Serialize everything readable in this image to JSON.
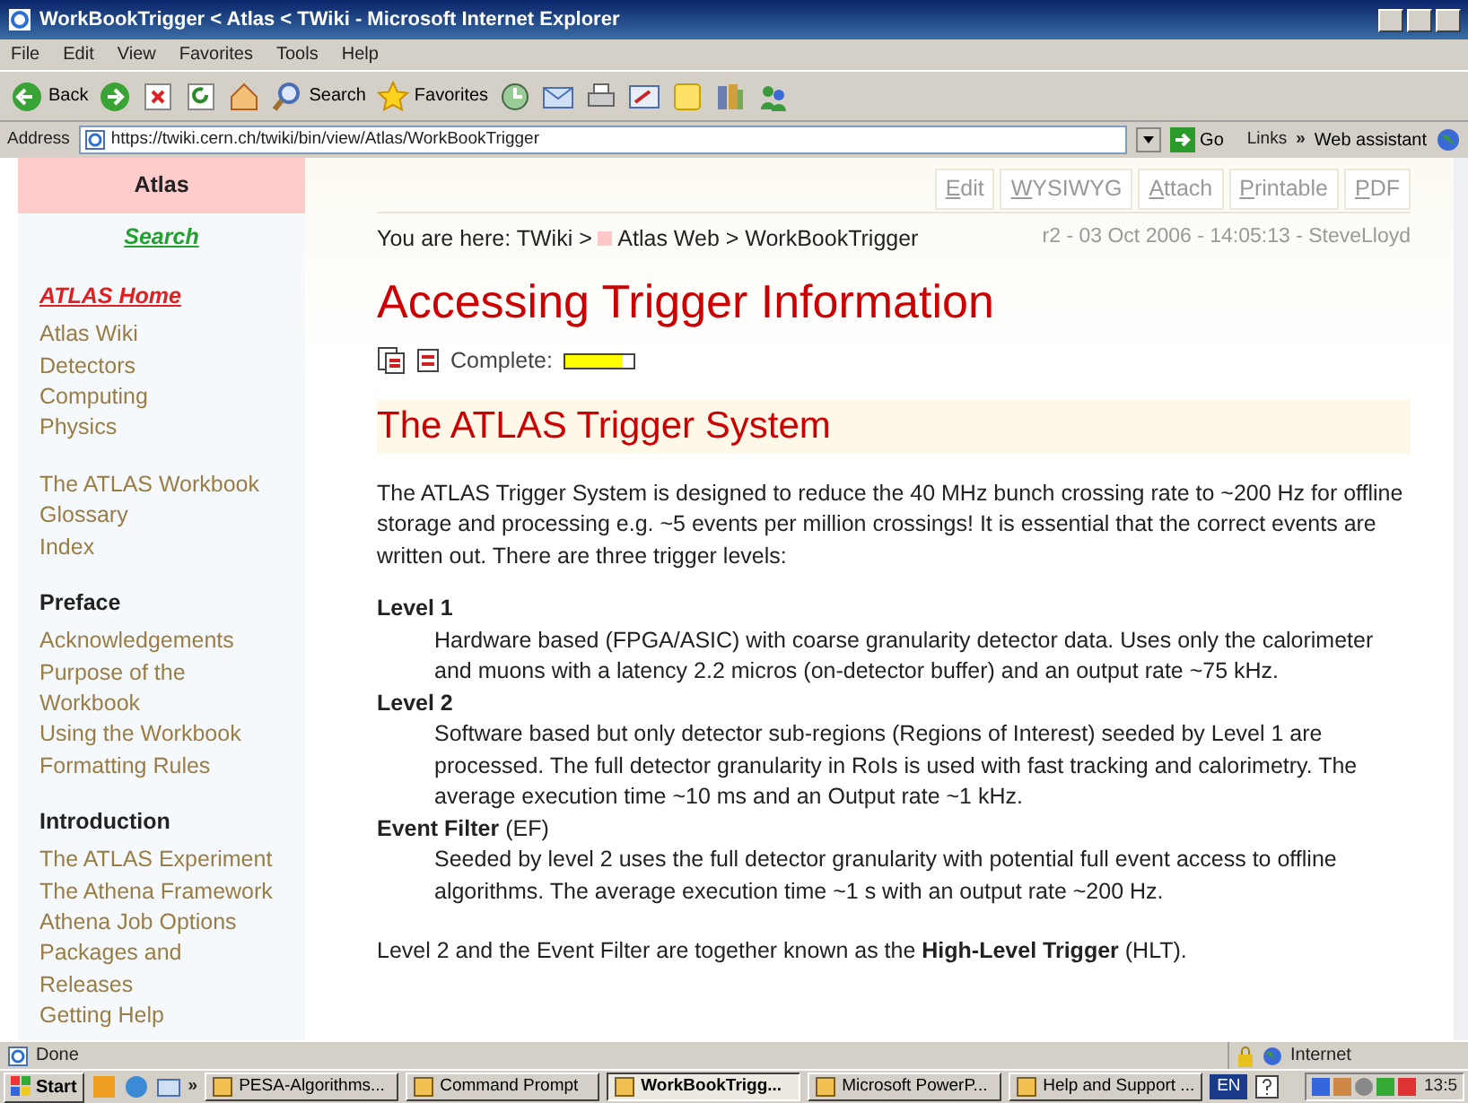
{
  "window": {
    "title": "WorkBookTrigger < Atlas < TWiki - Microsoft Internet Explorer"
  },
  "menu": [
    "File",
    "Edit",
    "View",
    "Favorites",
    "Tools",
    "Help"
  ],
  "toolbar": [
    {
      "kind": "back",
      "label": "Back"
    },
    {
      "kind": "forward"
    },
    {
      "kind": "stop"
    },
    {
      "kind": "refresh"
    },
    {
      "kind": "home"
    },
    {
      "kind": "search",
      "label": "Search"
    },
    {
      "kind": "favorites",
      "label": "Favorites"
    },
    {
      "kind": "history"
    },
    {
      "kind": "mail"
    },
    {
      "kind": "print"
    },
    {
      "kind": "edit"
    },
    {
      "kind": "note"
    },
    {
      "kind": "research"
    },
    {
      "kind": "messenger"
    }
  ],
  "address": {
    "label": "Address",
    "url": "https://twiki.cern.ch/twiki/bin/view/Atlas/WorkBookTrigger",
    "go": "Go",
    "links": "Links",
    "chevron": "»",
    "assistant": "Web assistant"
  },
  "sidebar": {
    "header": "Atlas",
    "search": "Search",
    "home": "ATLAS Home",
    "sections": [
      {
        "links": [
          "Atlas Wiki",
          "Detectors",
          "Computing",
          "Physics"
        ]
      },
      {
        "links": [
          "The ATLAS Workbook",
          "Glossary",
          "Index"
        ]
      },
      {
        "heading": "Preface",
        "links": [
          "Acknowledgements",
          "Purpose of the Workbook",
          "Using the Workbook",
          "Formatting Rules"
        ]
      },
      {
        "heading": "Introduction",
        "links": [
          "The ATLAS Experiment",
          "The Athena Framework",
          "Athena Job Options",
          "Packages and Releases",
          "Getting Help"
        ]
      }
    ]
  },
  "actions": [
    "Edit",
    "WYSIWYG",
    "Attach",
    "Printable",
    "PDF"
  ],
  "breadcrumb": {
    "prefix": "You are here:",
    "links": [
      "TWiki",
      "Atlas Web"
    ],
    "separator": ">",
    "current": "WorkBookTrigger"
  },
  "revision": "r2 - 03 Oct 2006 - 14:05:13 - SteveLloyd",
  "title": "Accessing Trigger Information",
  "complete": {
    "label": "Complete:",
    "level": 0.85
  },
  "section_title": "The ATLAS Trigger System",
  "intro": "The ATLAS Trigger System is designed to reduce the 40 MHz bunch crossing rate to ~200 Hz for offline storage and processing e.g. ~5 events per million crossings! It is essential that the correct events are written out. There are three trigger levels:",
  "levels": [
    {
      "term": "Level 1",
      "description": "Hardware based (FPGA/ASIC) with coarse granularity detector data. Uses only the calorimeter and muons with a latency 2.2 micros (on-detector buffer) and an output rate ~75 kHz."
    },
    {
      "term": "Level 2",
      "description": "Software based but only detector sub-regions (Regions of Interest) seeded by Level 1 are processed. The full detector granularity in RoIs is used with fast tracking and calorimetry. The average execution time ~10 ms and an Output rate ~1 kHz."
    },
    {
      "term": "Event Filter",
      "note": "(EF)",
      "description": "Seeded by level 2 uses the full detector granularity with potential full event access to offline algorithms. The average execution time ~1 s with an output rate ~200 Hz."
    }
  ],
  "closing": "Level 2 and the Event Filter are together known as the **High-Level Trigger** (HLT).",
  "status_bar": {
    "text": "Done",
    "zone": "Internet"
  },
  "taskbar": {
    "start": "Start",
    "chevron": "»",
    "tasks": [
      {
        "label": "PESA-Algorithms...",
        "selected": false
      },
      {
        "label": "Command Prompt",
        "selected": false
      },
      {
        "label": "WorkBookTrigg...",
        "selected": true
      },
      {
        "label": "Microsoft PowerP...",
        "selected": false
      },
      {
        "label": "Help and Support ...",
        "selected": false
      }
    ],
    "language": "EN",
    "clock": "13:5"
  }
}
